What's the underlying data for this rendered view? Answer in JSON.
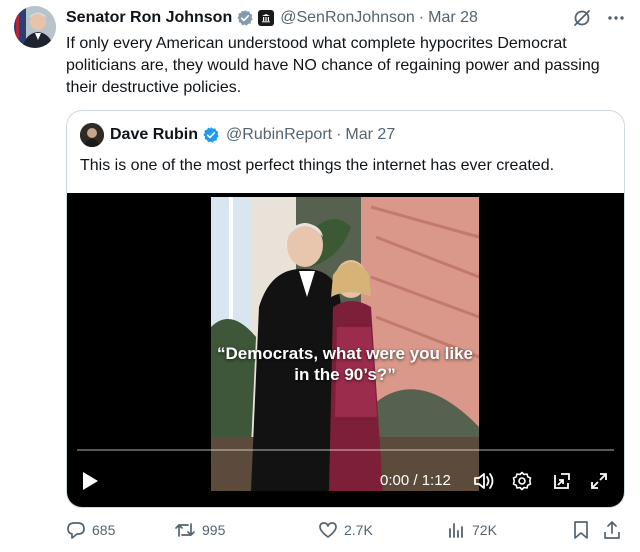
{
  "tweet": {
    "author_name": "Senator Ron Johnson",
    "handle": "@SenRonJohnson",
    "separator": "·",
    "date": "Mar 28",
    "text": "If only every American understood what complete hypocrites Democrat politicians are, they would have NO chance of regaining power and passing their destructive policies.",
    "icons": [
      "verified-badge-icon",
      "government-affiliation-icon",
      "grok-icon",
      "more-icon"
    ],
    "colors": {
      "verified_gray": "#829aab",
      "verified_blue": "#1d9bf0",
      "text": "#0f1419",
      "muted": "#536471",
      "border": "#cfd9de"
    }
  },
  "quote": {
    "author_name": "Dave Rubin",
    "handle": "@RubinReport",
    "separator": "·",
    "date": "Mar 27",
    "text": "This is one of the most perfect things the internet has ever created.",
    "video": {
      "caption": "“Democrats, what were you like in the 90’s?”",
      "time": "0:00 / 1:12",
      "progress": 0,
      "controls": [
        "play-icon",
        "volume-icon",
        "settings-icon",
        "picture-in-picture-icon",
        "fullscreen-icon"
      ]
    }
  },
  "actions": {
    "replies": "685",
    "reposts": "995",
    "likes": "2.7K",
    "views": "72K",
    "icons": [
      "reply-icon",
      "repost-icon",
      "like-icon",
      "views-icon",
      "bookmark-icon",
      "share-icon"
    ]
  }
}
